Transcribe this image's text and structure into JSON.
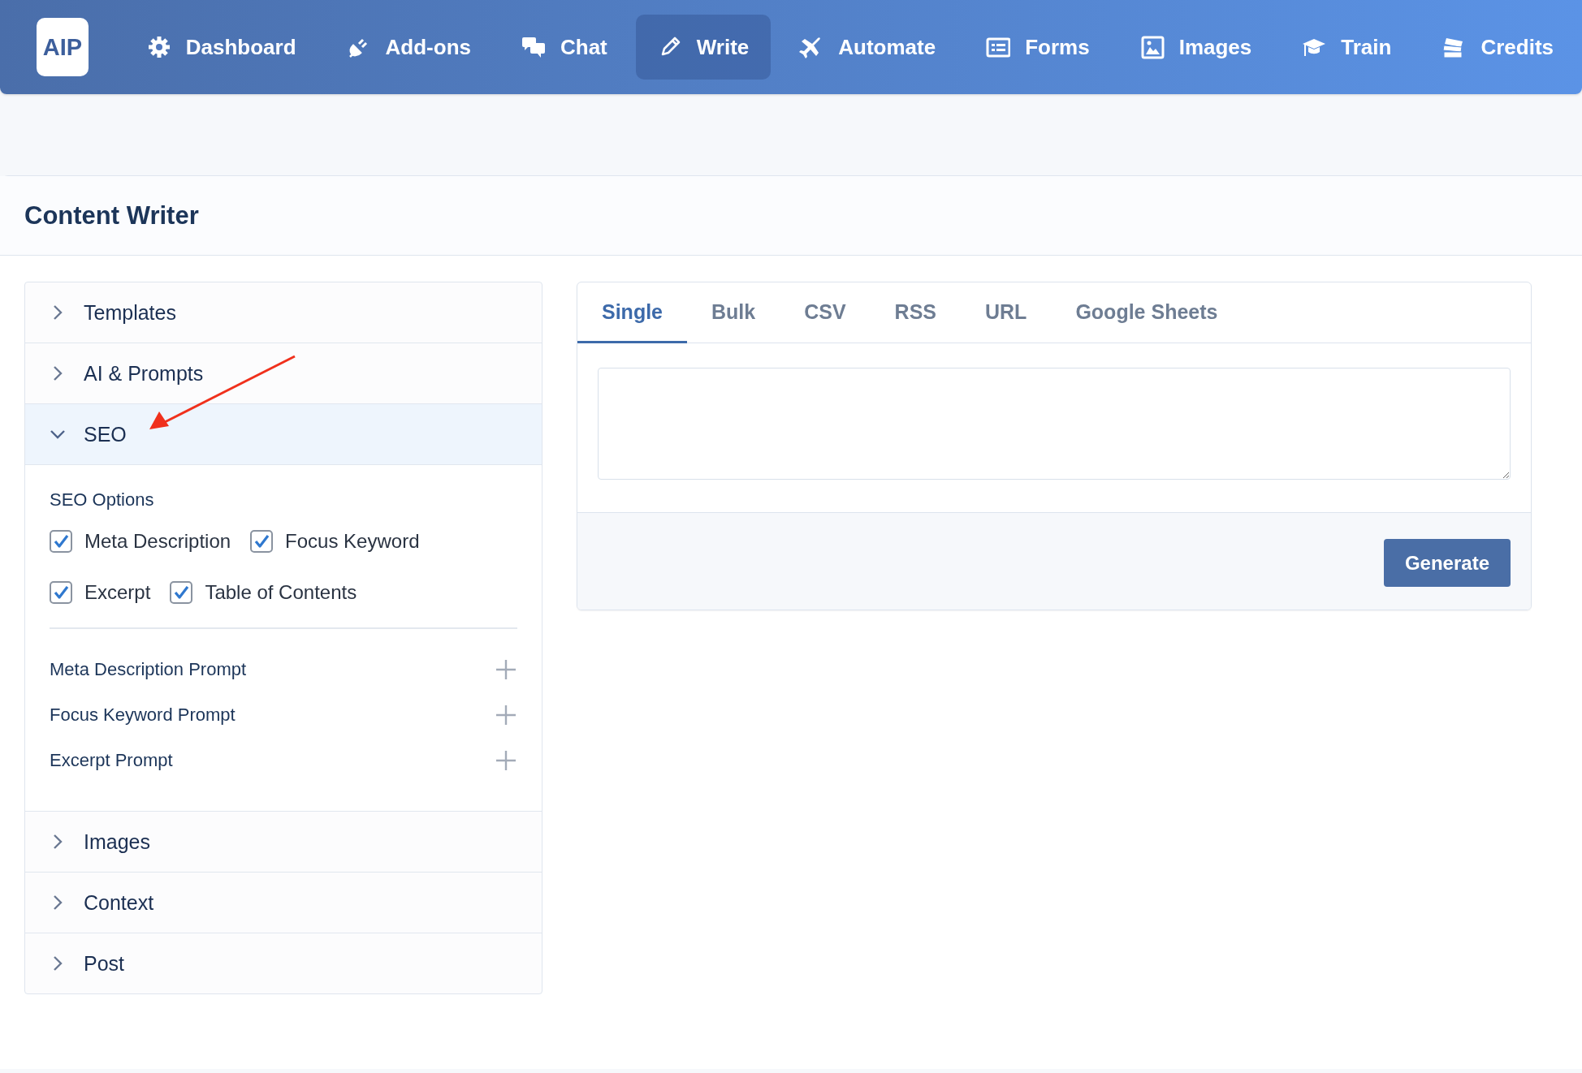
{
  "nav": {
    "logo": "AIP",
    "items": [
      {
        "label": "Dashboard",
        "selected": false
      },
      {
        "label": "Add-ons",
        "selected": false
      },
      {
        "label": "Chat",
        "selected": false
      },
      {
        "label": "Write",
        "selected": true
      },
      {
        "label": "Automate",
        "selected": false
      },
      {
        "label": "Forms",
        "selected": false
      },
      {
        "label": "Images",
        "selected": false
      },
      {
        "label": "Train",
        "selected": false
      },
      {
        "label": "Credits",
        "selected": false
      }
    ]
  },
  "page_title": "Content Writer",
  "sections": [
    {
      "title": "Templates",
      "expanded": false
    },
    {
      "title": "AI & Prompts",
      "expanded": false
    },
    {
      "title": "SEO",
      "expanded": true,
      "options_label": "SEO Options",
      "options": [
        [
          {
            "label": "Meta Description",
            "checked": true
          },
          {
            "label": "Focus Keyword",
            "checked": true
          }
        ],
        [
          {
            "label": "Excerpt",
            "checked": true
          },
          {
            "label": "Table of Contents",
            "checked": true
          }
        ]
      ],
      "prompts": [
        {
          "label": "Meta Description Prompt"
        },
        {
          "label": "Focus Keyword Prompt"
        },
        {
          "label": "Excerpt Prompt"
        }
      ]
    },
    {
      "title": "Images",
      "expanded": false
    },
    {
      "title": "Context",
      "expanded": false
    },
    {
      "title": "Post",
      "expanded": false
    }
  ],
  "tabs": [
    {
      "label": "Single",
      "selected": true
    },
    {
      "label": "Bulk",
      "selected": false
    },
    {
      "label": "CSV",
      "selected": false
    },
    {
      "label": "RSS",
      "selected": false
    },
    {
      "label": "URL",
      "selected": false
    },
    {
      "label": "Google Sheets",
      "selected": false
    }
  ],
  "generate_button": "Generate"
}
